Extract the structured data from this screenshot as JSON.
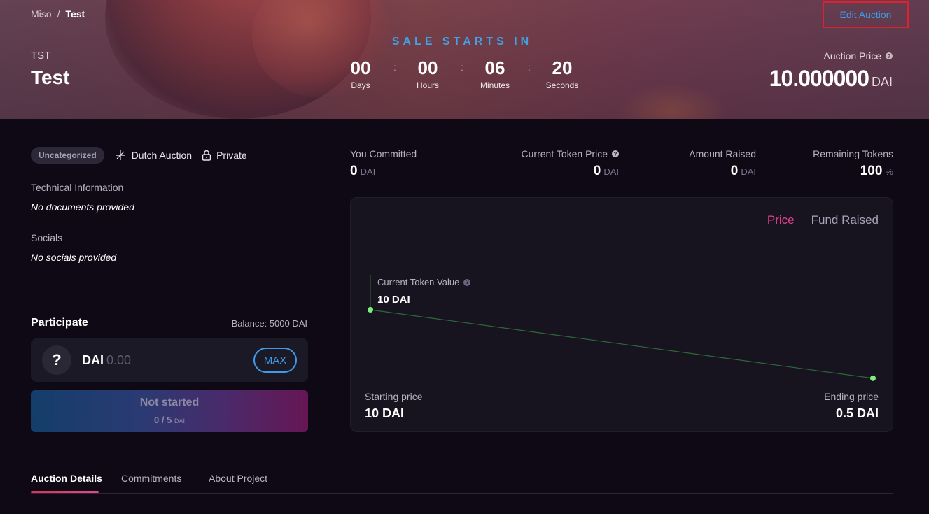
{
  "breadcrumb": {
    "root": "Miso",
    "separator": "/",
    "current": "Test"
  },
  "header": {
    "edit_button": "Edit Auction",
    "token_symbol": "TST",
    "token_name": "Test",
    "sale_label": "SALE STARTS IN",
    "countdown": [
      {
        "value": "00",
        "label": "Days"
      },
      {
        "value": "00",
        "label": "Hours"
      },
      {
        "value": "06",
        "label": "Minutes"
      },
      {
        "value": "20",
        "label": "Seconds"
      }
    ],
    "auction_price_label": "Auction Price",
    "auction_price_value": "10.000000",
    "auction_price_currency": "DAI"
  },
  "tags": {
    "category": "Uncategorized",
    "type": "Dutch Auction",
    "privacy": "Private"
  },
  "info": {
    "technical_label": "Technical Information",
    "technical_value": "No documents provided",
    "socials_label": "Socials",
    "socials_value": "No socials provided"
  },
  "participate": {
    "title": "Participate",
    "balance": "Balance: 5000 DAI",
    "token": "DAI",
    "placeholder": "0.00",
    "max_label": "MAX",
    "status": "Not started",
    "progress": "0 / 5",
    "progress_unit": "DAI"
  },
  "stats": {
    "committed": {
      "label": "You Committed",
      "value": "0",
      "unit": "DAI"
    },
    "token_price": {
      "label": "Current Token Price",
      "value": "0",
      "unit": "DAI"
    },
    "raised": {
      "label": "Amount Raised",
      "value": "0",
      "unit": "DAI"
    },
    "remaining": {
      "label": "Remaining Tokens",
      "value": "100",
      "unit": "%"
    }
  },
  "chart": {
    "tab_price": "Price",
    "tab_fund": "Fund Raised",
    "current_label": "Current Token Value",
    "current_value": "10 DAI",
    "start_label": "Starting price",
    "start_value": "10 DAI",
    "end_label": "Ending price",
    "end_value": "0.5 DAI",
    "line_color": "#2c6a38",
    "point_color": "#7cf07c"
  },
  "chart_data": {
    "type": "line",
    "x": [
      "start",
      "end"
    ],
    "series": [
      {
        "values": [
          10,
          0.5
        ]
      }
    ],
    "ylim": [
      0,
      10
    ]
  },
  "tabs": [
    {
      "label": "Auction Details"
    },
    {
      "label": "Commitments"
    },
    {
      "label": "About Project"
    }
  ],
  "colors": {
    "accent_blue": "#3d9be9",
    "accent_pink": "#e5408f",
    "highlight_red": "#e0202a"
  }
}
